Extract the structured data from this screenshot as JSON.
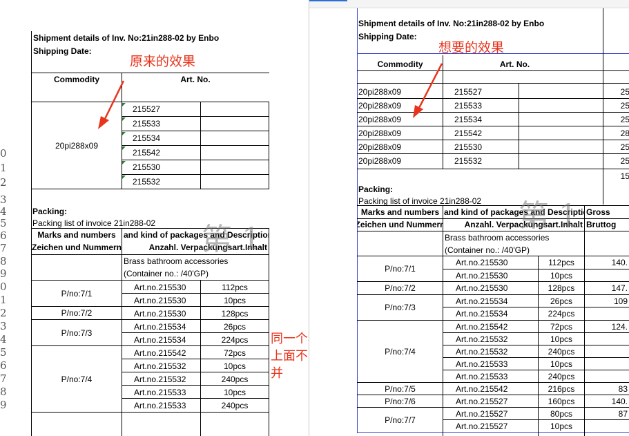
{
  "colors": {
    "annotation": "#e8341c",
    "page_border": "#3b46c8",
    "cell_marker": "#2e7d32"
  },
  "left": {
    "row_numbers": [
      "0",
      "1",
      "2",
      "3",
      "4",
      "5",
      "6",
      "7",
      "8",
      "9",
      "0",
      "1",
      "2",
      "3",
      "4",
      "5",
      "6",
      "7",
      "8",
      "9"
    ],
    "title": "Shipment details of Inv. No:21in288-02 by Enbo",
    "shipping_date": "Shipping Date:",
    "annotation": "原来的效果",
    "col_commodity": "Commodity",
    "col_artno": "Art. No.",
    "commodity_merged": "20pi288x09",
    "art_numbers": [
      "215527",
      "215533",
      "215534",
      "215542",
      "215530",
      "215532"
    ],
    "packing_label": "Packing:",
    "packing_list": "Packing list of invoice 21in288-02",
    "marks_header": "Marks and numbers",
    "kind_header": "and kind of packages and Description",
    "zeichen_header": "Zeichen und Nummern",
    "anzahl_header": "Anzahl. Verpackungsart.Inhalt",
    "desc1": "Brass bathroom accessories",
    "desc2": "(Container no.:   /40'GP)",
    "pno_labels": [
      "P/no:7/1",
      "P/no:7/2",
      "P/no:7/3",
      "P/no:7/4"
    ],
    "items": [
      {
        "art": "Art.no.215530",
        "qty": "112pcs"
      },
      {
        "art": "Art.no.215530",
        "qty": "10pcs"
      },
      {
        "art": "Art.no.215530",
        "qty": "128pcs"
      },
      {
        "art": "Art.no.215534",
        "qty": "26pcs"
      },
      {
        "art": "Art.no.215534",
        "qty": "224pcs"
      },
      {
        "art": "Art.no.215542",
        "qty": "72pcs"
      },
      {
        "art": "Art.no.215532",
        "qty": "10pcs"
      },
      {
        "art": "Art.no.215532",
        "qty": "240pcs"
      },
      {
        "art": "Art.no.215533",
        "qty": "10pcs"
      },
      {
        "art": "Art.no.215533",
        "qty": "240pcs"
      }
    ],
    "watermark": "第 1"
  },
  "middle_annotation": {
    "line1": "同一个模板中，同一列",
    "line2": "上面不合并，下面的合",
    "line3": "并"
  },
  "right": {
    "title": "Shipment details of Inv. No:21in288-02 by Enbo",
    "shipping_date": "Shipping Date:",
    "annotation": "想要的效果",
    "col_commodity": "Commodity",
    "col_artno": "Art. No.",
    "rows": [
      {
        "commodity": "20pi288x09",
        "art": "215527",
        "num": "25"
      },
      {
        "commodity": "20pi288x09",
        "art": "215533",
        "num": "25"
      },
      {
        "commodity": "20pi288x09",
        "art": "215534",
        "num": "25"
      },
      {
        "commodity": "20pi288x09",
        "art": "215542",
        "num": "28"
      },
      {
        "commodity": "20pi288x09",
        "art": "215530",
        "num": "25"
      },
      {
        "commodity": "20pi288x09",
        "art": "215532",
        "num": "25"
      }
    ],
    "total": "15",
    "packing_label": "Packing:",
    "packing_list": "Packing list of invoice 21in288-02",
    "marks_header": "Marks and numbers",
    "kind_header": "and kind of packages and Description",
    "gross_header": "Gross",
    "zeichen_header": "Zeichen und Nummern",
    "anzahl_header": "Anzahl. Verpackungsart.Inhalt",
    "brutto_header": "Bruttog",
    "desc1": "Brass bathroom accessories",
    "desc2": "(Container no.:   /40'GP)",
    "pno_labels": [
      "P/no:7/1",
      "P/no:7/2",
      "P/no:7/3",
      "P/no:7/4",
      "P/no:7/5",
      "P/no:7/6",
      "P/no:7/7"
    ],
    "items": [
      {
        "art": "Art.no.215530",
        "qty": "112pcs",
        "gross": "140."
      },
      {
        "art": "Art.no.215530",
        "qty": "10pcs",
        "gross": ""
      },
      {
        "art": "Art.no.215530",
        "qty": "128pcs",
        "gross": "147."
      },
      {
        "art": "Art.no.215534",
        "qty": "26pcs",
        "gross": "109"
      },
      {
        "art": "Art.no.215534",
        "qty": "224pcs",
        "gross": ""
      },
      {
        "art": "Art.no.215542",
        "qty": "72pcs",
        "gross": "124."
      },
      {
        "art": "Art.no.215532",
        "qty": "10pcs",
        "gross": ""
      },
      {
        "art": "Art.no.215532",
        "qty": "240pcs",
        "gross": ""
      },
      {
        "art": "Art.no.215533",
        "qty": "10pcs",
        "gross": ""
      },
      {
        "art": "Art.no.215533",
        "qty": "240pcs",
        "gross": ""
      },
      {
        "art": "Art.no.215542",
        "qty": "216pcs",
        "gross": "83"
      },
      {
        "art": "Art.no.215527",
        "qty": "160pcs",
        "gross": "140."
      },
      {
        "art": "Art.no.215527",
        "qty": "80pcs",
        "gross": "87"
      },
      {
        "art": "Art.no.215527",
        "qty": "10pcs",
        "gross": ""
      }
    ],
    "watermark": "第 1"
  }
}
